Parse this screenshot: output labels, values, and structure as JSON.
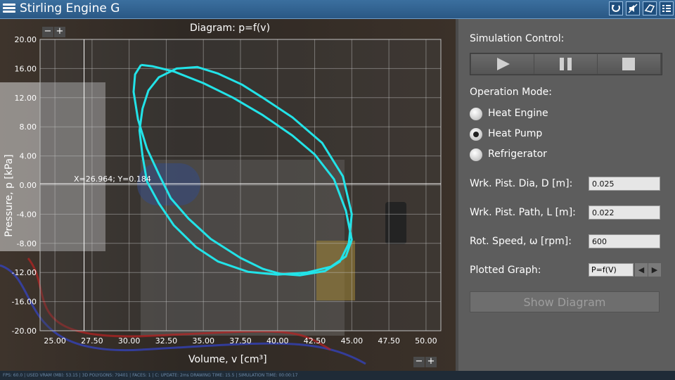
{
  "app": {
    "title": "Stirling Engine G"
  },
  "titlebar_icons": [
    "refresh-icon",
    "mute-icon",
    "perspective-icon",
    "settings-list-icon"
  ],
  "chart_title": "Diagram: p=f(v)",
  "cursor_readout": "X=26.964; Y=0.184",
  "zoom": {
    "minus": "−",
    "plus": "+"
  },
  "status_line": "FPS: 60.0 | USED VRAM (MB): 53.15 | 3D POLYGONS: 79401 | FACES: 1 | C: UPDATE: 2ms DRAWING TIME: 15.5 | SIMULATION TIME: 00:00:17",
  "chart_data": {
    "type": "line",
    "title": "Diagram: p=f(v)",
    "xlabel": "Volume, v [cm³]",
    "ylabel": "Pressure, p [kPa]",
    "xlim": [
      24,
      51
    ],
    "ylim": [
      -20,
      20
    ],
    "x_ticks": [
      "25.00",
      "27.50",
      "30.00",
      "32.50",
      "35.00",
      "37.50",
      "40.00",
      "42.50",
      "45.00",
      "47.50",
      "50.00"
    ],
    "y_ticks": [
      "20.00",
      "16.00",
      "12.00",
      "8.00",
      "4.00",
      "0.00",
      "-4.00",
      "-8.00",
      "-12.00",
      "-16.00",
      "-20.00"
    ],
    "grid": true,
    "cursor": {
      "x": 26.964,
      "y": 0.184
    },
    "series": [
      {
        "color": "#22e3e8",
        "x": [
          30.8,
          31.6,
          33.0,
          35.0,
          37.0,
          39.0,
          41.0,
          42.5,
          43.8,
          44.6,
          45.0,
          44.6,
          43.6,
          42.0,
          40.0,
          38.0,
          36.0,
          34.5,
          33.0,
          32.0,
          31.2,
          30.9,
          30.7,
          30.9,
          31.3,
          32.0,
          33.2,
          34.6,
          36.0,
          37.6,
          39.0,
          41.0,
          43.0,
          44.4,
          45.0,
          44.8,
          44.2,
          43.2,
          41.5,
          40.2,
          39.0,
          37.5,
          35.5,
          34.0,
          32.8,
          32.0,
          31.2,
          30.6,
          30.3,
          30.4,
          30.8
        ],
        "y": [
          16.5,
          16.3,
          15.6,
          14.0,
          12.0,
          9.6,
          6.8,
          4.2,
          0.8,
          -3.5,
          -7.5,
          -9.8,
          -11.2,
          -12.0,
          -12.3,
          -11.9,
          -10.5,
          -8.5,
          -5.5,
          -2.5,
          0.5,
          4.0,
          7.5,
          10.5,
          13.0,
          14.8,
          16.0,
          16.2,
          15.3,
          13.8,
          12.0,
          9.3,
          5.8,
          1.2,
          -4.0,
          -8.0,
          -10.5,
          -11.8,
          -12.4,
          -12.2,
          -11.5,
          -10.0,
          -7.4,
          -4.6,
          -1.8,
          1.5,
          5.0,
          9.0,
          12.8,
          15.2,
          16.5
        ]
      }
    ]
  },
  "panel": {
    "simulation_control_label": "Simulation Control:",
    "operation_mode_label": "Operation Mode:",
    "modes": [
      {
        "label": "Heat Engine",
        "selected": false
      },
      {
        "label": "Heat Pump",
        "selected": true
      },
      {
        "label": "Refrigerator",
        "selected": false
      }
    ],
    "fields": [
      {
        "label": "Wrk. Pist. Dia, D [m]:",
        "value": "0.025"
      },
      {
        "label": "Wrk. Pist. Path, L [m]:",
        "value": "0.022"
      },
      {
        "label": "Rot. Speed, ω [rpm]:",
        "value": "600"
      }
    ],
    "plotted_graph_label": "Plotted Graph:",
    "plotted_graph_value": "P=f(V)",
    "show_diagram_label": "Show Diagram"
  },
  "colors": {
    "titlebar": "#2a5885",
    "curve": "#22e3e8",
    "panel": "#5d5d5d"
  }
}
